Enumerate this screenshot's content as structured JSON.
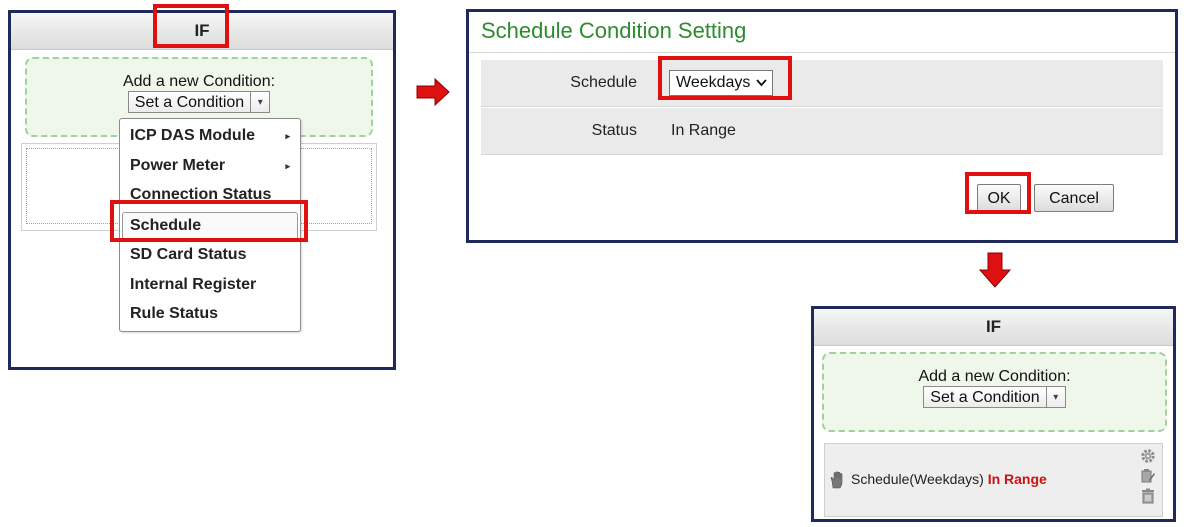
{
  "if_panel": {
    "header": "IF",
    "add_label": "Add a new Condition:",
    "combo_text": "Set a Condition",
    "combo_arrow": "▾"
  },
  "menu": {
    "items": [
      {
        "label": "ICP DAS Module",
        "has_submenu": true
      },
      {
        "label": "Power Meter",
        "has_submenu": true
      },
      {
        "label": "Connection Status",
        "has_submenu": false
      },
      {
        "label": "Schedule",
        "has_submenu": false
      },
      {
        "label": "SD Card Status",
        "has_submenu": false
      },
      {
        "label": "Internal Register",
        "has_submenu": false
      },
      {
        "label": "Rule Status",
        "has_submenu": false
      }
    ],
    "submenu_arrow": "▸"
  },
  "dialog": {
    "title": "Schedule Condition Setting",
    "schedule_label": "Schedule",
    "schedule_value": "Weekdays",
    "status_label": "Status",
    "status_value": "In Range",
    "ok_label": "OK",
    "cancel_label": "Cancel"
  },
  "result_panel": {
    "header": "IF",
    "add_label": "Add a new Condition:",
    "combo_text": "Set a Condition",
    "combo_arrow": "▾",
    "condition_text": "Schedule(Weekdays)",
    "condition_status": "In Range"
  },
  "colors": {
    "panel_border": "#1f2a5a",
    "highlight": "#e01010",
    "title_green": "#2e8b2e",
    "status_red": "#cc1111",
    "dashed_green": "#9fd09f"
  },
  "icons": [
    "right-arrow-icon",
    "down-arrow-icon",
    "hand-icon",
    "gear-icon",
    "edit-icon",
    "trash-icon",
    "chevron-down-icon"
  ]
}
